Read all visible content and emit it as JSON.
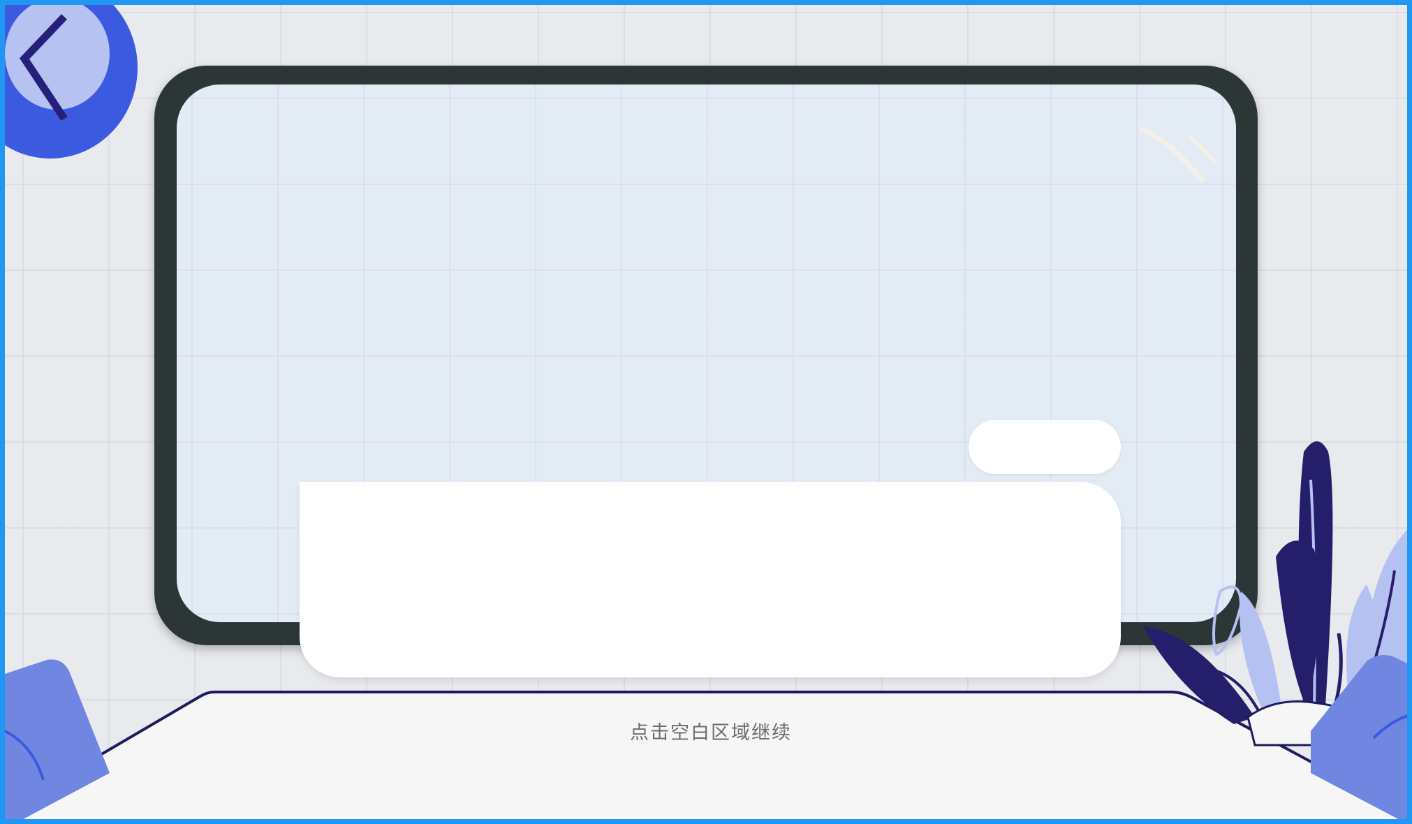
{
  "hint": {
    "continue_text": "点击空白区域继续"
  },
  "icons": {
    "back": "chevron-left-icon",
    "plant": "plant-decoration-icon",
    "pot": "pot-decoration-icon",
    "glare": "screen-glare-icon"
  },
  "colors": {
    "border": "#1f97f3",
    "back_button_outer": "#3b5ae0",
    "back_button_inner": "#b6c2f2",
    "back_chevron": "#26207a",
    "tv_frame": "#2c3637",
    "tv_screen": "#e3ebf5",
    "card": "#ffffff",
    "table_top": "#f6f6f7",
    "table_edge": "#1e1b5c",
    "plant_dark": "#241e6b",
    "plant_light": "#b5c1f1",
    "pot": "#7086e0"
  }
}
